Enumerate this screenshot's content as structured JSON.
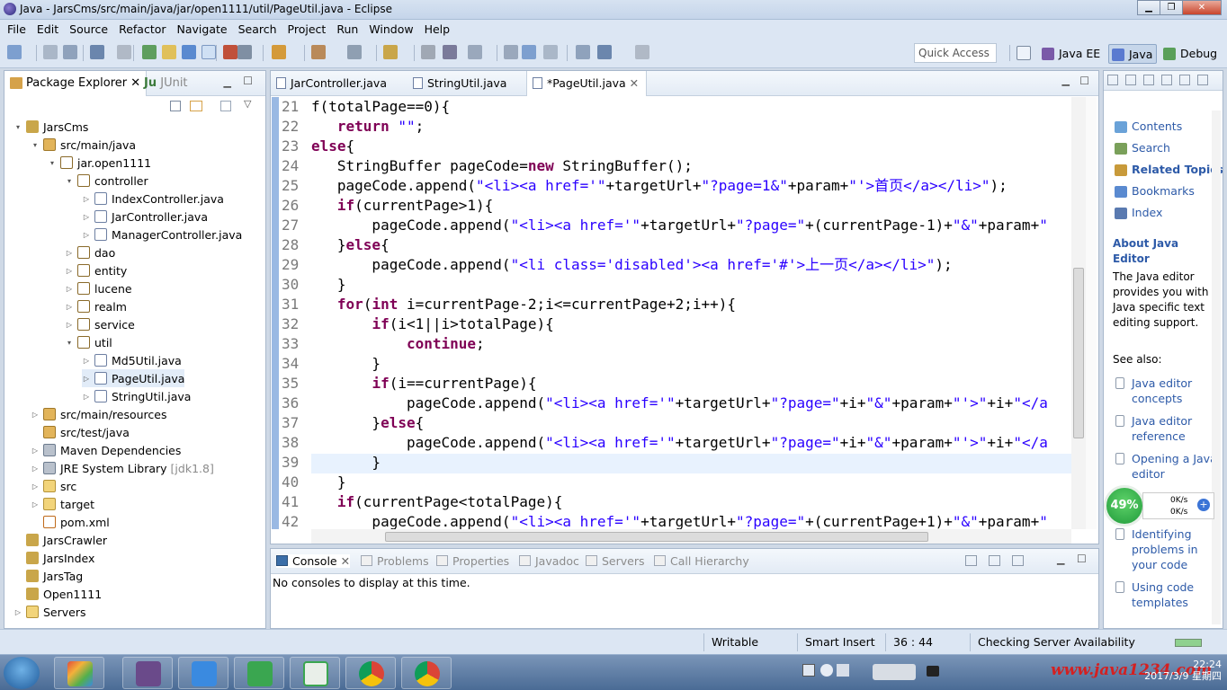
{
  "window": {
    "title": "Java - JarsCms/src/main/java/jar/open1111/util/PageUtil.java - Eclipse"
  },
  "menu": [
    "File",
    "Edit",
    "Source",
    "Refactor",
    "Navigate",
    "Search",
    "Project",
    "Run",
    "Window",
    "Help"
  ],
  "quick_access": "Quick Access",
  "perspectives": [
    {
      "label": "Java EE",
      "active": false
    },
    {
      "label": "Java",
      "active": true
    },
    {
      "label": "Debug",
      "active": false
    }
  ],
  "package_explorer": {
    "tab": "Package Explorer",
    "tab2": "JUnit",
    "tree": [
      {
        "label": "JarsCms",
        "icon": "proj",
        "level": 0,
        "tw": "▾"
      },
      {
        "label": "src/main/java",
        "icon": "src",
        "level": 1,
        "tw": "▾"
      },
      {
        "label": "jar.open1111",
        "icon": "pkg",
        "level": 2,
        "tw": "▾"
      },
      {
        "label": "controller",
        "icon": "pkg",
        "level": 3,
        "tw": "▾"
      },
      {
        "label": "IndexController.java",
        "icon": "java",
        "level": 4,
        "tw": "▷"
      },
      {
        "label": "JarController.java",
        "icon": "java",
        "level": 4,
        "tw": "▷"
      },
      {
        "label": "ManagerController.java",
        "icon": "java",
        "level": 4,
        "tw": "▷"
      },
      {
        "label": "dao",
        "icon": "pkg",
        "level": 3,
        "tw": "▷"
      },
      {
        "label": "entity",
        "icon": "pkg",
        "level": 3,
        "tw": "▷"
      },
      {
        "label": "lucene",
        "icon": "pkg",
        "level": 3,
        "tw": "▷"
      },
      {
        "label": "realm",
        "icon": "pkg",
        "level": 3,
        "tw": "▷"
      },
      {
        "label": "service",
        "icon": "pkg",
        "level": 3,
        "tw": "▷"
      },
      {
        "label": "util",
        "icon": "pkg",
        "level": 3,
        "tw": "▾"
      },
      {
        "label": "Md5Util.java",
        "icon": "java",
        "level": 4,
        "tw": "▷"
      },
      {
        "label": "PageUtil.java",
        "icon": "java",
        "level": 4,
        "tw": "▷",
        "selected": true
      },
      {
        "label": "StringUtil.java",
        "icon": "java",
        "level": 4,
        "tw": "▷"
      },
      {
        "label": "src/main/resources",
        "icon": "src",
        "level": 1,
        "tw": "▷"
      },
      {
        "label": "src/test/java",
        "icon": "src",
        "level": 1,
        "tw": ""
      },
      {
        "label": "Maven Dependencies",
        "icon": "lib",
        "level": 1,
        "tw": "▷"
      },
      {
        "label": "JRE System Library",
        "suffix": "[jdk1.8]",
        "icon": "lib",
        "level": 1,
        "tw": "▷"
      },
      {
        "label": "src",
        "icon": "fold",
        "level": 1,
        "tw": "▷"
      },
      {
        "label": "target",
        "icon": "fold",
        "level": 1,
        "tw": "▷"
      },
      {
        "label": "pom.xml",
        "icon": "xml",
        "level": 1,
        "tw": ""
      },
      {
        "label": "JarsCrawler",
        "icon": "proj",
        "level": 0,
        "tw": ""
      },
      {
        "label": "JarsIndex",
        "icon": "proj",
        "level": 0,
        "tw": ""
      },
      {
        "label": "JarsTag",
        "icon": "proj",
        "level": 0,
        "tw": ""
      },
      {
        "label": "Open1111",
        "icon": "proj",
        "level": 0,
        "tw": ""
      },
      {
        "label": "Servers",
        "icon": "fold",
        "level": 0,
        "tw": "▷"
      }
    ]
  },
  "editor": {
    "tabs": [
      {
        "label": "JarController.java",
        "active": false
      },
      {
        "label": "StringUtil.java",
        "active": false
      },
      {
        "label": "*PageUtil.java",
        "active": true
      }
    ],
    "lines": [
      {
        "n": "21",
        "c": "f(totalPage==0){"
      },
      {
        "n": "22",
        "c": "   return \"\";"
      },
      {
        "n": "23",
        "c": "else{"
      },
      {
        "n": "24",
        "c": "   StringBuffer pageCode=new StringBuffer();"
      },
      {
        "n": "25",
        "c": "   pageCode.append(\"<li><a href='\"+targetUrl+\"?page=1&\"+param+\"'>首页</a></li>\");"
      },
      {
        "n": "26",
        "c": "   if(currentPage>1){"
      },
      {
        "n": "27",
        "c": "       pageCode.append(\"<li><a href='\"+targetUrl+\"?page=\"+(currentPage-1)+\"&\"+param+\""
      },
      {
        "n": "28",
        "c": "   }else{"
      },
      {
        "n": "29",
        "c": "       pageCode.append(\"<li class='disabled'><a href='#'>上一页</a></li>\");"
      },
      {
        "n": "30",
        "c": "   }"
      },
      {
        "n": "31",
        "c": "   for(int i=currentPage-2;i<=currentPage+2;i++){"
      },
      {
        "n": "32",
        "c": "       if(i<1||i>totalPage){"
      },
      {
        "n": "33",
        "c": "           continue;"
      },
      {
        "n": "34",
        "c": "       }"
      },
      {
        "n": "35",
        "c": "       if(i==currentPage){"
      },
      {
        "n": "36",
        "c": "           pageCode.append(\"<li><a href='\"+targetUrl+\"?page=\"+i+\"&\"+param+\"'>\"+i+\"</a"
      },
      {
        "n": "37",
        "c": "       }else{"
      },
      {
        "n": "38",
        "c": "           pageCode.append(\"<li><a href='\"+targetUrl+\"?page=\"+i+\"&\"+param+\"'>\"+i+\"</a"
      },
      {
        "n": "39",
        "c": "       }"
      },
      {
        "n": "40",
        "c": "   }"
      },
      {
        "n": "41",
        "c": "   if(currentPage<totalPage){"
      },
      {
        "n": "42",
        "c": "       pageCode.append(\"<li><a href='\"+targetUrl+\"?page=\"+(currentPage+1)+\"&\"+param+\""
      }
    ]
  },
  "console": {
    "tabs": [
      "Console",
      "Problems",
      "Properties",
      "Javadoc",
      "Servers",
      "Call Hierarchy"
    ],
    "message": "No consoles to display at this time."
  },
  "help": {
    "links": [
      "Contents",
      "Search",
      "Related Topics",
      "Bookmarks",
      "Index"
    ],
    "heading": "About Java Editor",
    "body": "The Java editor provides you with Java specific text editing support.",
    "see_also": "See also:",
    "sub_links": [
      "Java editor concepts",
      "Java editor reference",
      "Opening a Java editor",
      "Identifying problems in your code",
      "Using code templates"
    ]
  },
  "net_widget": {
    "percent": "49%",
    "up": "0K/s",
    "down": "0K/s"
  },
  "status": {
    "writable": "Writable",
    "insert": "Smart Insert",
    "position": "36 : 44",
    "task": "Checking Server Availability"
  },
  "taskbar": {
    "watermark": "www.java1234.com",
    "time": "22:24",
    "date": "2017/3/9 星期四"
  }
}
